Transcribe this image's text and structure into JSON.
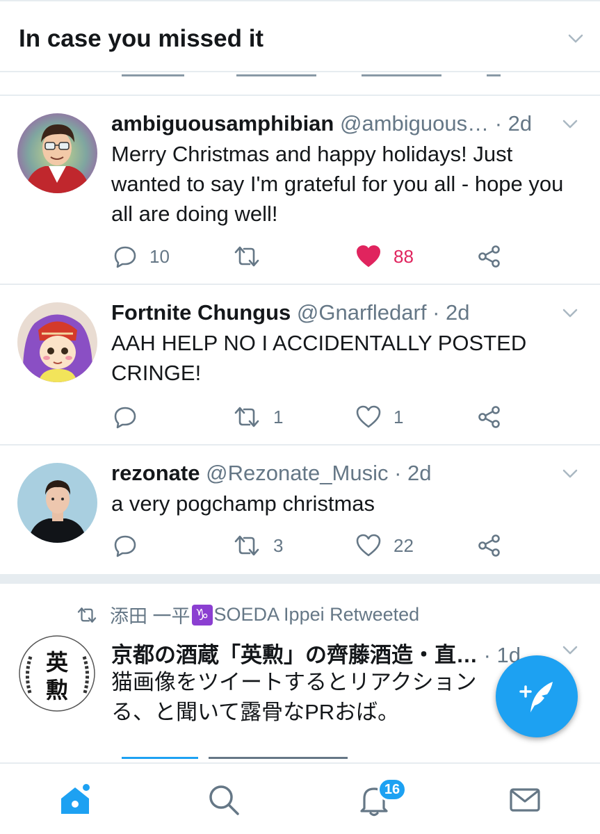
{
  "header": {
    "title": "In case you missed it"
  },
  "tweets": [
    {
      "name": "ambiguousamphibian",
      "handle": "@ambiguous…",
      "time": "· 2d",
      "text": "Merry Christmas and happy holidays! Just wanted to say I'm grateful for you all - hope you all are doing well!",
      "replies": "10",
      "retweets": "",
      "likes": "88",
      "liked": true
    },
    {
      "name": "Fortnite Chungus",
      "handle": "@Gnarfledarf",
      "time": "· 2d",
      "text": "AAH HELP NO I ACCIDENTALLY POSTED CRINGE!",
      "replies": "",
      "retweets": "1",
      "likes": "1",
      "liked": false
    },
    {
      "name": "rezonate",
      "handle": "@Rezonate_Music",
      "time": "· 2d",
      "text": "a very pogchamp christmas",
      "replies": "",
      "retweets": "3",
      "likes": "22",
      "liked": false
    },
    {
      "retweet_by_prefix": "添田 一平",
      "retweet_by_sign": "♑",
      "retweet_by_suffix": "SOEDA Ippei Retweeted",
      "name": "京都の酒蔵「英勲」の齊藤酒造・直…",
      "time": "· 1d",
      "text": "猫画像をツイートするとリアクション る、と聞いて露骨なPRおば。",
      "avatar_text_top": "英",
      "avatar_text_bottom": "勲"
    }
  ],
  "nav": {
    "notifications_badge": "16"
  },
  "colors": {
    "accent": "#1da1f2",
    "like": "#e0245e",
    "muted": "#657786"
  },
  "icons": [
    "chevron-down-icon",
    "reply-icon",
    "retweet-icon",
    "heart-icon",
    "share-icon",
    "compose-icon",
    "home-icon",
    "search-icon",
    "bell-icon",
    "mail-icon"
  ]
}
